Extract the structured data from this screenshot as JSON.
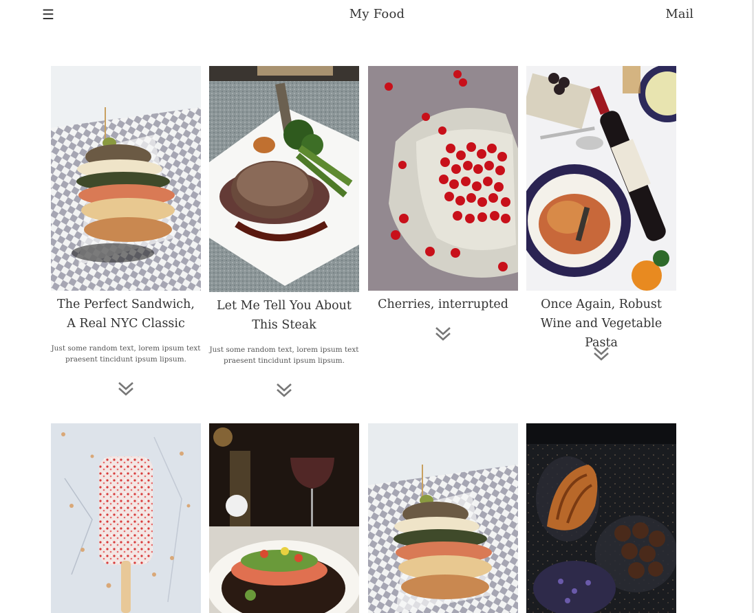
{
  "header": {
    "menu_icon": "☰",
    "title": "My Food",
    "mail_label": "Mail"
  },
  "cards_row1": [
    {
      "title": "The Perfect Sandwich, A Real NYC Classic",
      "description": "Just some random text, lorem ipsum text praesent tincidunt ipsum lipsum.",
      "image": "sandwich"
    },
    {
      "title": "Let Me Tell You About This Steak",
      "description": "Just some random text, lorem ipsum text praesent tincidunt ipsum lipsum.",
      "image": "steak"
    },
    {
      "title": "Cherries, interrupted",
      "image": "cherries"
    },
    {
      "title": "Once Again, Robust Wine and Vegetable Pasta",
      "image": "wine-pasta"
    }
  ],
  "cards_row2": [
    {
      "image": "popsicle"
    },
    {
      "image": "salmon"
    },
    {
      "image": "sandwich"
    },
    {
      "image": "croissant"
    }
  ],
  "colors": {
    "text": "#333333",
    "icon": "#777777",
    "background": "#ffffff"
  }
}
